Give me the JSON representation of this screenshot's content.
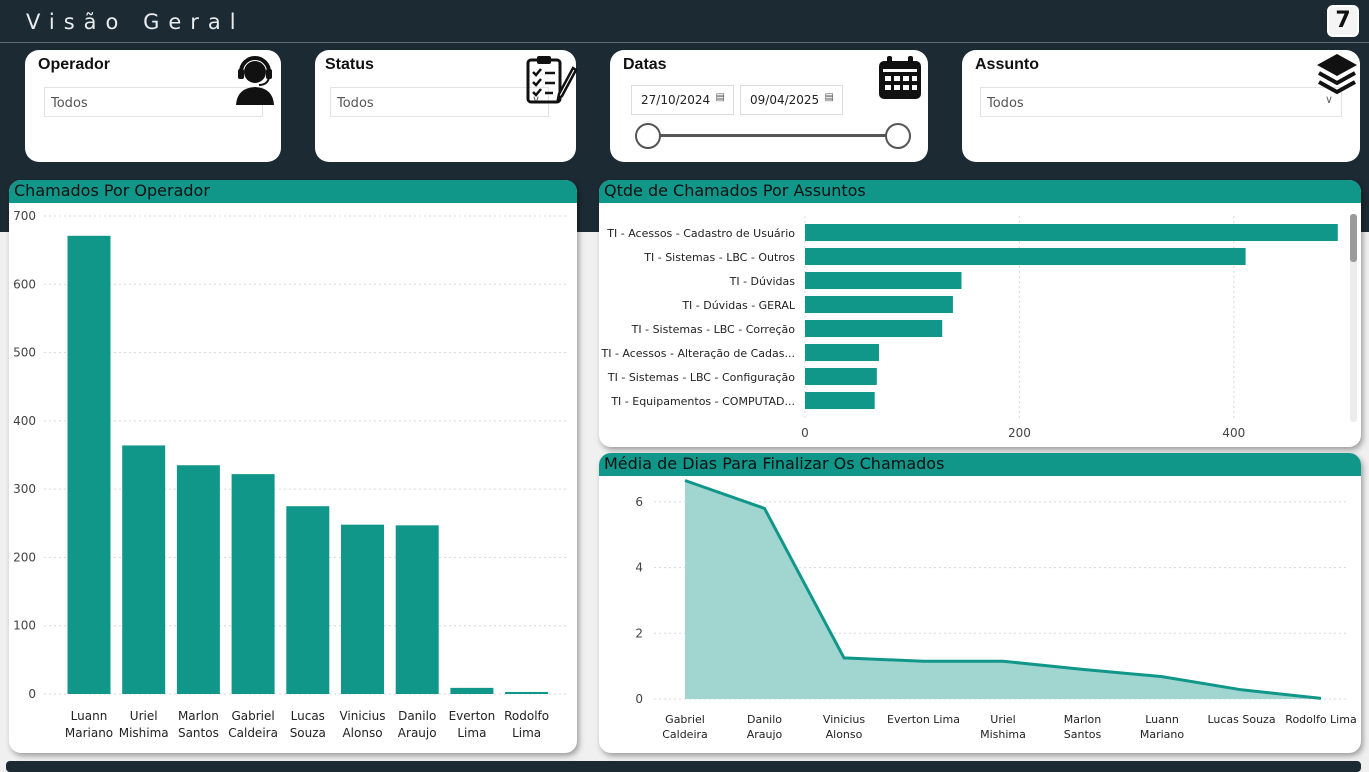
{
  "page": {
    "title": "Visão Geral",
    "logo_text": "7"
  },
  "colors": {
    "header_bg": "#1c2a33",
    "accent": "#11978a",
    "area_fill": "#a0d5d0"
  },
  "filters": {
    "operador": {
      "title": "Operador",
      "value": "Todos",
      "icon": "headset-operator-icon"
    },
    "status": {
      "title": "Status",
      "value": "Todos",
      "icon": "clipboard-checklist-icon"
    },
    "datas": {
      "title": "Datas",
      "start": "27/10/2024",
      "end": "09/04/2025",
      "icon": "calendar-icon"
    },
    "assunto": {
      "title": "Assunto",
      "value": "Todos",
      "icon": "layers-icon"
    }
  },
  "chart_data": [
    {
      "type": "bar",
      "title": "Chamados Por Operador",
      "categories": [
        "Luann Mariano",
        "Uriel Mishima",
        "Marlon Santos",
        "Gabriel Caldeira",
        "Lucas Souza",
        "Vinicius Alonso",
        "Danilo Araujo",
        "Everton Lima",
        "Rodolfo Lima"
      ],
      "category_lines": [
        [
          "Luann",
          "Mariano"
        ],
        [
          "Uriel",
          "Mishima"
        ],
        [
          "Marlon",
          "Santos"
        ],
        [
          "Gabriel",
          "Caldeira"
        ],
        [
          "Lucas",
          "Souza"
        ],
        [
          "Vinicius",
          "Alonso"
        ],
        [
          "Danilo",
          "Araujo"
        ],
        [
          "Everton",
          "Lima"
        ],
        [
          "Rodolfo",
          "Lima"
        ]
      ],
      "values": [
        671,
        364,
        335,
        322,
        275,
        248,
        247,
        9,
        3
      ],
      "ylim": [
        0,
        700
      ],
      "yticks": [
        "0",
        "100",
        "200",
        "300",
        "400",
        "500",
        "600",
        "700"
      ],
      "grid": true
    },
    {
      "type": "bar",
      "orientation": "horizontal",
      "title": "Qtde de Chamados Por Assuntos",
      "categories": [
        "TI - Acessos - Cadastro de Usuário",
        "TI - Sistemas - LBC - Outros",
        "TI - Dúvidas",
        "TI - Dúvidas - GERAL",
        "TI - Sistemas - LBC - Correção",
        "TI - Acessos - Alteração de Cadas...",
        "TI - Sistemas - LBC - Configuração",
        "TI - Equipamentos - COMPUTAD..."
      ],
      "values": [
        497,
        411,
        146,
        138,
        128,
        69,
        67,
        65
      ],
      "xlim": [
        0,
        500
      ],
      "xticks": [
        "0",
        "200",
        "400"
      ],
      "grid": true
    },
    {
      "type": "area",
      "title": "Média de Dias Para Finalizar Os Chamados",
      "categories": [
        "Gabriel Caldeira",
        "Danilo Araujo",
        "Vinicius Alonso",
        "Everton Lima",
        "Uriel Mishima",
        "Marlon Santos",
        "Luann Mariano",
        "Lucas Souza",
        "Rodolfo Lima"
      ],
      "category_lines": [
        [
          "Gabriel",
          "Caldeira"
        ],
        [
          "Danilo",
          "Araujo"
        ],
        [
          "Vinicius",
          "Alonso"
        ],
        [
          "Everton Lima"
        ],
        [
          "Uriel",
          "Mishima"
        ],
        [
          "Marlon",
          "Santos"
        ],
        [
          "Luann",
          "Mariano"
        ],
        [
          "Lucas Souza"
        ],
        [
          "Rodolfo Lima"
        ]
      ],
      "values": [
        6.65,
        5.8,
        1.25,
        1.15,
        1.15,
        0.9,
        0.68,
        0.28,
        0.02
      ],
      "ylim": [
        0,
        7
      ],
      "yticks": [
        "0",
        "2",
        "4",
        "6"
      ],
      "grid": true
    }
  ]
}
